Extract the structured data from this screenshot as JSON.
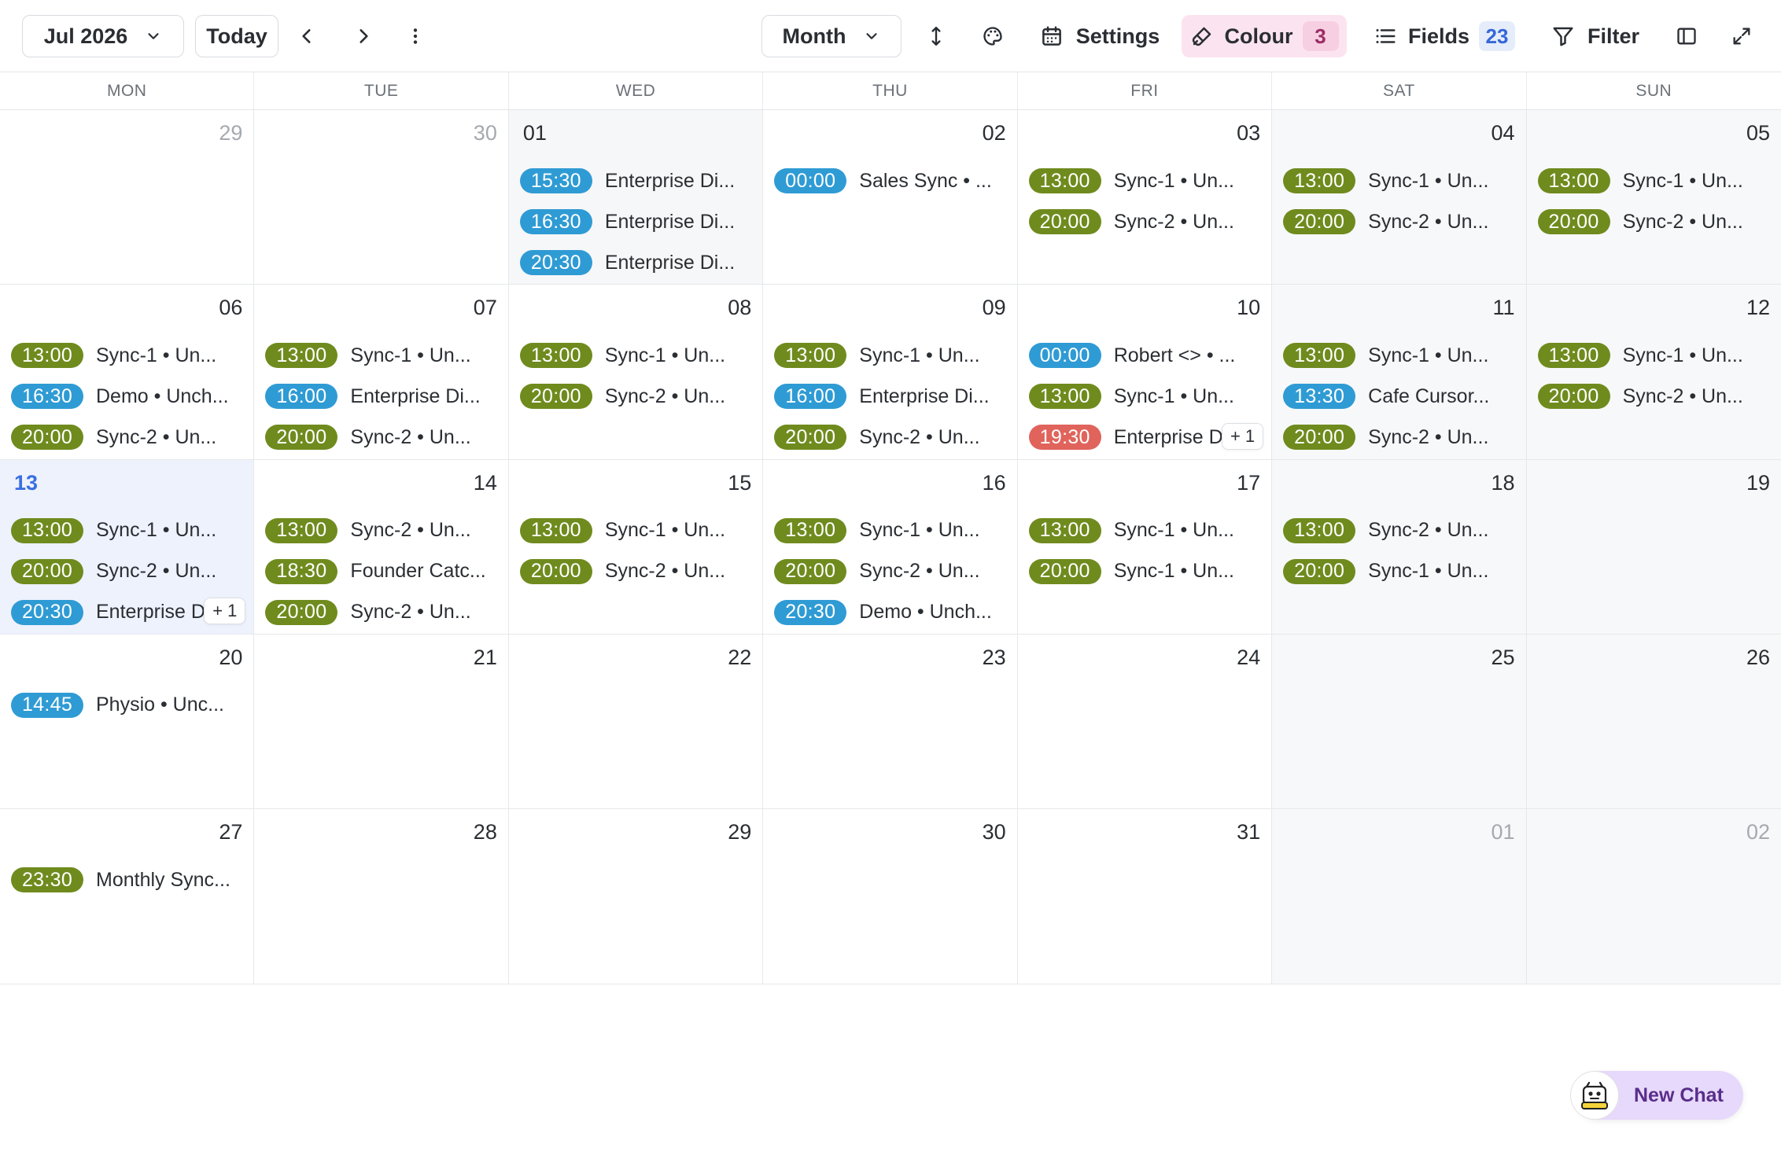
{
  "toolbar": {
    "month_label": "Jul 2026",
    "today_label": "Today",
    "view_label": "Month",
    "settings_label": "Settings",
    "colour_label": "Colour",
    "colour_count": "3",
    "fields_label": "Fields",
    "fields_count": "23",
    "filter_label": "Filter"
  },
  "colors": {
    "green": "#6f8b1e",
    "blue": "#2f9bd4",
    "red": "#e0645c",
    "colour_badge_bg": "#fbe4ef",
    "colour_count_bg": "#f7cfe2",
    "colour_count_text": "#9b2d63",
    "fields_count_bg": "#e5edfb",
    "fields_count_text": "#3567d8"
  },
  "weekdays": [
    "MON",
    "TUE",
    "WED",
    "THU",
    "FRI",
    "SAT",
    "SUN"
  ],
  "days": [
    {
      "num": "29",
      "muted": true,
      "events": []
    },
    {
      "num": "30",
      "muted": true,
      "events": []
    },
    {
      "num": "01",
      "shaded": true,
      "left": true,
      "events": [
        {
          "time": "15:30",
          "color": "blue",
          "title": "Enterprise Di..."
        },
        {
          "time": "16:30",
          "color": "blue",
          "title": "Enterprise Di..."
        },
        {
          "time": "20:30",
          "color": "blue",
          "title": "Enterprise Di..."
        }
      ]
    },
    {
      "num": "02",
      "events": [
        {
          "time": "00:00",
          "color": "blue",
          "title": "Sales Sync • ..."
        }
      ]
    },
    {
      "num": "03",
      "events": [
        {
          "time": "13:00",
          "color": "green",
          "title": "Sync-1 • Un..."
        },
        {
          "time": "20:00",
          "color": "green",
          "title": "Sync-2 • Un..."
        }
      ]
    },
    {
      "num": "04",
      "weekend": true,
      "events": [
        {
          "time": "13:00",
          "color": "green",
          "title": "Sync-1 • Un..."
        },
        {
          "time": "20:00",
          "color": "green",
          "title": "Sync-2 • Un..."
        }
      ]
    },
    {
      "num": "05",
      "weekend": true,
      "events": [
        {
          "time": "13:00",
          "color": "green",
          "title": "Sync-1 • Un..."
        },
        {
          "time": "20:00",
          "color": "green",
          "title": "Sync-2 • Un..."
        }
      ]
    },
    {
      "num": "06",
      "events": [
        {
          "time": "13:00",
          "color": "green",
          "title": "Sync-1 • Un..."
        },
        {
          "time": "16:30",
          "color": "blue",
          "title": "Demo • Unch..."
        },
        {
          "time": "20:00",
          "color": "green",
          "title": "Sync-2 • Un..."
        }
      ]
    },
    {
      "num": "07",
      "events": [
        {
          "time": "13:00",
          "color": "green",
          "title": "Sync-1 • Un..."
        },
        {
          "time": "16:00",
          "color": "blue",
          "title": "Enterprise Di..."
        },
        {
          "time": "20:00",
          "color": "green",
          "title": "Sync-2 • Un..."
        }
      ]
    },
    {
      "num": "08",
      "events": [
        {
          "time": "13:00",
          "color": "green",
          "title": "Sync-1 • Un..."
        },
        {
          "time": "20:00",
          "color": "green",
          "title": "Sync-2 • Un..."
        }
      ]
    },
    {
      "num": "09",
      "events": [
        {
          "time": "13:00",
          "color": "green",
          "title": "Sync-1 • Un..."
        },
        {
          "time": "16:00",
          "color": "blue",
          "title": "Enterprise Di..."
        },
        {
          "time": "20:00",
          "color": "green",
          "title": "Sync-2 • Un..."
        }
      ]
    },
    {
      "num": "10",
      "more": "+ 1",
      "events": [
        {
          "time": "00:00",
          "color": "blue",
          "title": "Robert <> • ..."
        },
        {
          "time": "13:00",
          "color": "green",
          "title": "Sync-1 • Un..."
        },
        {
          "time": "19:30",
          "color": "red",
          "title": "Enterprise Di..."
        }
      ]
    },
    {
      "num": "11",
      "weekend": true,
      "events": [
        {
          "time": "13:00",
          "color": "green",
          "title": "Sync-1 • Un..."
        },
        {
          "time": "13:30",
          "color": "blue",
          "title": "Cafe Cursor..."
        },
        {
          "time": "20:00",
          "color": "green",
          "title": "Sync-2 • Un..."
        }
      ]
    },
    {
      "num": "12",
      "weekend": true,
      "events": [
        {
          "time": "13:00",
          "color": "green",
          "title": "Sync-1 • Un..."
        },
        {
          "time": "20:00",
          "color": "green",
          "title": "Sync-2 • Un..."
        }
      ]
    },
    {
      "num": "13",
      "today": true,
      "left": true,
      "more": "+ 1",
      "events": [
        {
          "time": "13:00",
          "color": "green",
          "title": "Sync-1 • Un..."
        },
        {
          "time": "20:00",
          "color": "green",
          "title": "Sync-2 • Un..."
        },
        {
          "time": "20:30",
          "color": "blue",
          "title": "Enterprise Di..."
        }
      ]
    },
    {
      "num": "14",
      "events": [
        {
          "time": "13:00",
          "color": "green",
          "title": "Sync-2 • Un..."
        },
        {
          "time": "18:30",
          "color": "green",
          "title": "Founder Catc..."
        },
        {
          "time": "20:00",
          "color": "green",
          "title": "Sync-2 • Un..."
        }
      ]
    },
    {
      "num": "15",
      "events": [
        {
          "time": "13:00",
          "color": "green",
          "title": "Sync-1 • Un..."
        },
        {
          "time": "20:00",
          "color": "green",
          "title": "Sync-2 • Un..."
        }
      ]
    },
    {
      "num": "16",
      "events": [
        {
          "time": "13:00",
          "color": "green",
          "title": "Sync-1 • Un..."
        },
        {
          "time": "20:00",
          "color": "green",
          "title": "Sync-2 • Un..."
        },
        {
          "time": "20:30",
          "color": "blue",
          "title": "Demo • Unch..."
        }
      ]
    },
    {
      "num": "17",
      "events": [
        {
          "time": "13:00",
          "color": "green",
          "title": "Sync-1 • Un..."
        },
        {
          "time": "20:00",
          "color": "green",
          "title": "Sync-1 • Un..."
        }
      ]
    },
    {
      "num": "18",
      "weekend": true,
      "events": [
        {
          "time": "13:00",
          "color": "green",
          "title": "Sync-2 • Un..."
        },
        {
          "time": "20:00",
          "color": "green",
          "title": "Sync-1 • Un..."
        }
      ]
    },
    {
      "num": "19",
      "weekend": true,
      "events": []
    },
    {
      "num": "20",
      "events": [
        {
          "time": "14:45",
          "color": "blue",
          "title": "Physio • Unc..."
        }
      ]
    },
    {
      "num": "21",
      "events": []
    },
    {
      "num": "22",
      "events": []
    },
    {
      "num": "23",
      "events": []
    },
    {
      "num": "24",
      "events": []
    },
    {
      "num": "25",
      "weekend": true,
      "events": []
    },
    {
      "num": "26",
      "weekend": true,
      "events": []
    },
    {
      "num": "27",
      "events": [
        {
          "time": "23:30",
          "color": "green",
          "title": "Monthly Sync..."
        }
      ]
    },
    {
      "num": "28",
      "events": []
    },
    {
      "num": "29",
      "events": []
    },
    {
      "num": "30",
      "events": []
    },
    {
      "num": "31",
      "events": []
    },
    {
      "num": "01",
      "weekend": true,
      "muted": true,
      "events": []
    },
    {
      "num": "02",
      "weekend": true,
      "muted": true,
      "events": []
    }
  ],
  "new_chat": {
    "label": "New Chat",
    "avatar_icon": "robot-avatar-icon"
  }
}
